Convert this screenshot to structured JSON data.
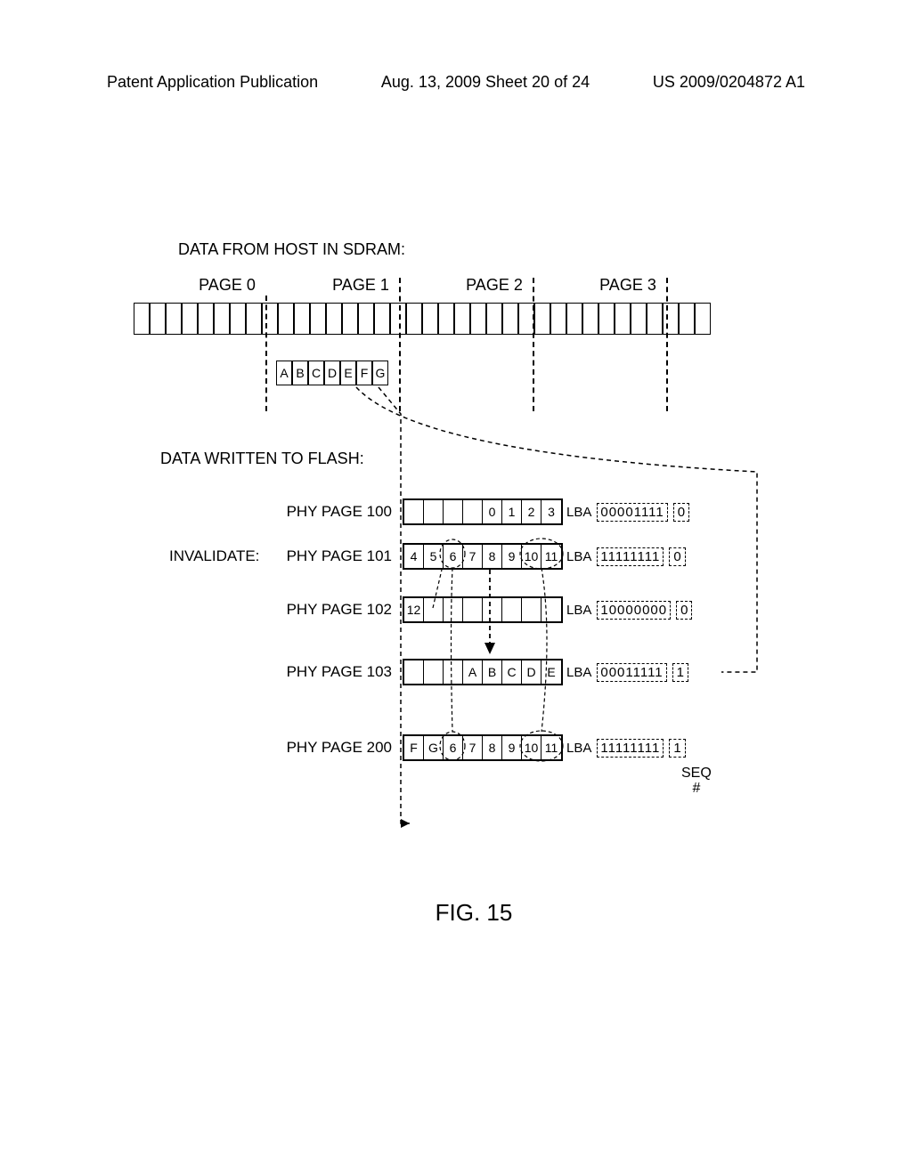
{
  "header": {
    "left": "Patent Application Publication",
    "center": "Aug. 13, 2009  Sheet 20 of 24",
    "right": "US 2009/0204872 A1"
  },
  "figure": {
    "title_upper": "DATA FROM HOST IN SDRAM:",
    "pages": [
      "PAGE 0",
      "PAGE 1",
      "PAGE 2",
      "PAGE 3"
    ],
    "new_data": [
      "A",
      "B",
      "C",
      "D",
      "E",
      "F",
      "G"
    ],
    "title_lower": "DATA WRITTEN TO FLASH:",
    "invalidate_label": "INVALIDATE:",
    "phy_rows": [
      {
        "label": "PHY PAGE 100",
        "cells": [
          "",
          "",
          "",
          "",
          "0",
          "1",
          "2",
          "3"
        ],
        "lba": "LBA",
        "bits": "00001111",
        "seq": "0"
      },
      {
        "label": "PHY PAGE 101",
        "cells": [
          "4",
          "5",
          "6",
          "7",
          "8",
          "9",
          "10",
          "11"
        ],
        "lba": "LBA",
        "bits": "11111111",
        "seq": "0"
      },
      {
        "label": "PHY PAGE 102",
        "cells": [
          "12",
          "",
          "",
          "",
          "",
          "",
          "",
          ""
        ],
        "lba": "LBA",
        "bits": "10000000",
        "seq": "0"
      },
      {
        "label": "PHY PAGE 103",
        "cells": [
          "",
          "",
          "",
          "A",
          "B",
          "C",
          "D",
          "E"
        ],
        "lba": "LBA",
        "bits": "00011111",
        "seq": "1"
      },
      {
        "label": "PHY PAGE 200",
        "cells": [
          "F",
          "G",
          "6",
          "7",
          "8",
          "9",
          "10",
          "11"
        ],
        "lba": "LBA",
        "bits": "11111111",
        "seq": "1"
      }
    ],
    "seq_label": "SEQ\n#",
    "caption": "FIG. 15"
  }
}
